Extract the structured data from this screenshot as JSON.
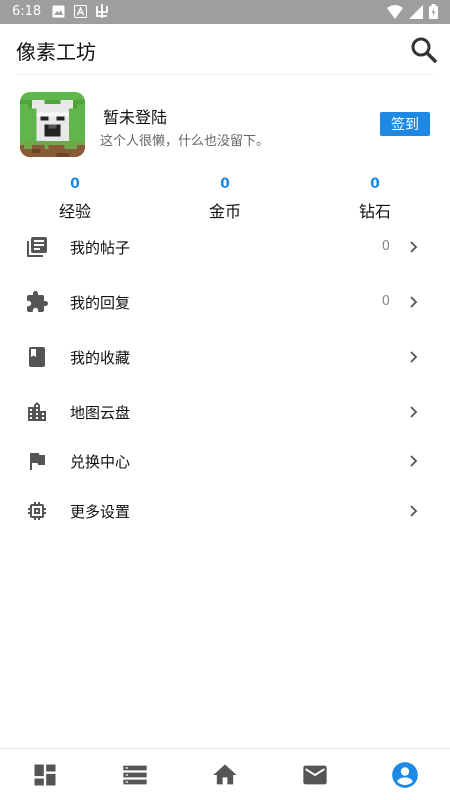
{
  "status_bar": {
    "time": "6:18",
    "icons": [
      "image-icon",
      "font-a-icon",
      "bug-icon"
    ],
    "right_icons": [
      "wifi-icon",
      "signal-icon",
      "battery-icon"
    ]
  },
  "header": {
    "title": "像素工坊"
  },
  "profile": {
    "name": "暂未登陆",
    "signature": "这个人很懒，什么也没留下。",
    "checkin_label": "签到"
  },
  "stats": [
    {
      "value": "0",
      "label": "经验"
    },
    {
      "value": "0",
      "label": "金币"
    },
    {
      "value": "0",
      "label": "钻石"
    }
  ],
  "menu": [
    {
      "label": "我的帖子",
      "count": "0",
      "icon": "posts-icon"
    },
    {
      "label": "我的回复",
      "count": "0",
      "icon": "puzzle-icon"
    },
    {
      "label": "我的收藏",
      "count": "",
      "icon": "bookmark-icon"
    },
    {
      "label": "地图云盘",
      "count": "",
      "icon": "city-icon"
    },
    {
      "label": "兑换中心",
      "count": "",
      "icon": "flag-icon"
    },
    {
      "label": "更多设置",
      "count": "",
      "icon": "chip-icon"
    }
  ],
  "bottom_nav": [
    {
      "icon": "dashboard-icon",
      "active": false
    },
    {
      "icon": "list-icon",
      "active": false
    },
    {
      "icon": "home-icon",
      "active": false
    },
    {
      "icon": "mail-icon",
      "active": false
    },
    {
      "icon": "account-icon",
      "active": true
    }
  ],
  "colors": {
    "accent": "#1e88e5",
    "icon_gray": "#555555",
    "status_bar": "#9e9e9e"
  }
}
